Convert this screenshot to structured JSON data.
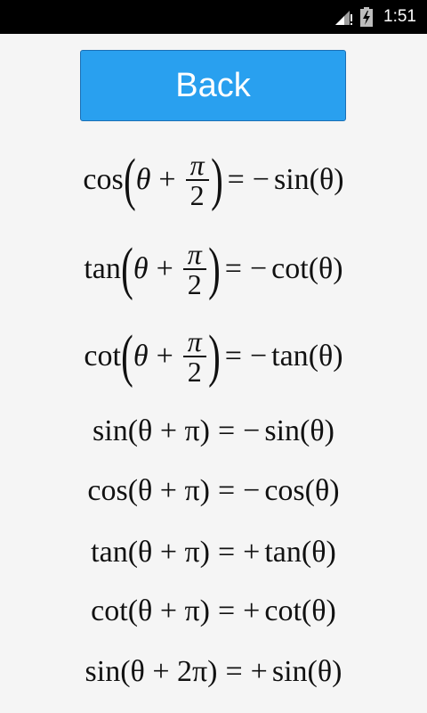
{
  "status_bar": {
    "time": "1:51",
    "icons": [
      "signal-icon",
      "battery-charging-icon"
    ]
  },
  "back_button": {
    "label": "Back"
  },
  "identities": [
    {
      "lhs_func": "cos",
      "theta": "θ",
      "plus": "+",
      "pi": "π",
      "two": "2",
      "eq": "=",
      "sign": "−",
      "rhs_func": "sin",
      "rhs_arg": "(θ)"
    },
    {
      "lhs_func": "tan",
      "theta": "θ",
      "plus": "+",
      "pi": "π",
      "two": "2",
      "eq": "=",
      "sign": "−",
      "rhs_func": "cot",
      "rhs_arg": "(θ)"
    },
    {
      "lhs_func": "cot",
      "theta": "θ",
      "plus": "+",
      "pi": "π",
      "two": "2",
      "eq": "=",
      "sign": "−",
      "rhs_func": "tan",
      "rhs_arg": "(θ)"
    },
    {
      "lhs": "sin(θ + π)",
      "eq": "=",
      "sign": "−",
      "rhs": "sin(θ)"
    },
    {
      "lhs": "cos(θ + π)",
      "eq": "=",
      "sign": "−",
      "rhs": "cos(θ)"
    },
    {
      "lhs": "tan(θ + π)",
      "eq": "=",
      "sign": "+",
      "rhs": "tan(θ)"
    },
    {
      "lhs": "cot(θ + π)",
      "eq": "=",
      "sign": "+",
      "rhs": "cot(θ)"
    },
    {
      "lhs": "sin(θ + 2π)",
      "eq": "=",
      "sign": "+",
      "rhs": "sin(θ)"
    }
  ],
  "colors": {
    "button": "#29a0ef",
    "background": "#f5f5f5",
    "status_bar": "#000000"
  }
}
